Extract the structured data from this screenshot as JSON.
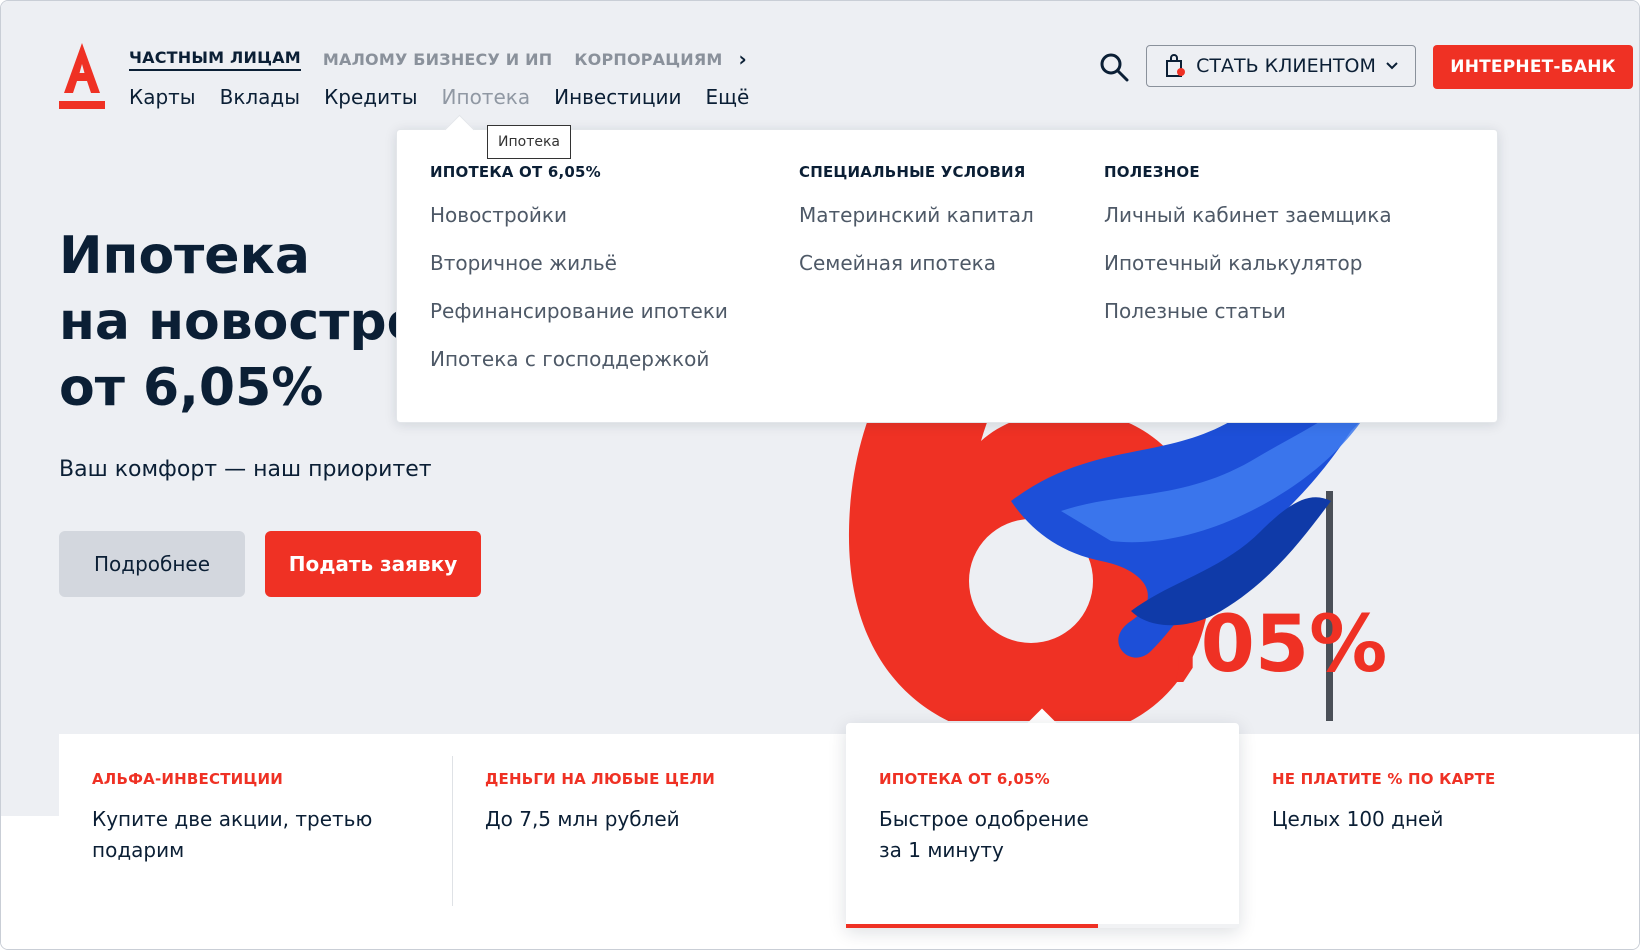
{
  "header": {
    "segments": [
      "ЧАСТНЫМ ЛИЦАМ",
      "МАЛОМУ БИЗНЕСУ И ИП",
      "КОРПОРАЦИЯМ"
    ],
    "active_segment": "ЧАСТНЫМ ЛИЦАМ",
    "nav": [
      "Карты",
      "Вклады",
      "Кредиты",
      "Ипотека",
      "Инвестиции",
      "Ещё"
    ],
    "hovered_nav": "Ипотека",
    "become_client": "СТАТЬ КЛИЕНТОМ",
    "internet_bank": "ИНТЕРНЕТ-БАНК",
    "search_icon": "search-icon",
    "brand_color": "#ef3124"
  },
  "tooltip": "Ипотека",
  "dropdown": {
    "columns": [
      {
        "heading": "ИПОТЕКА ОТ 6,05%",
        "items": [
          "Новостройки",
          "Вторичное жильё",
          "Рефинансирование ипотеки",
          "Ипотека с господдержкой"
        ]
      },
      {
        "heading": "СПЕЦИАЛЬНЫЕ УСЛОВИЯ",
        "items": [
          "Материнский капитал",
          "Семейная ипотека"
        ]
      },
      {
        "heading": "ПОЛЕЗНОЕ",
        "items": [
          "Личный кабинет заемщика",
          "Ипотечный калькулятор",
          "Полезные статьи"
        ]
      }
    ]
  },
  "hero": {
    "title_lines": [
      "Ипотека",
      "на новостро",
      "от 6,05%"
    ],
    "subtitle": "Ваш комфорт — наш приоритет",
    "more_button": "Подробнее",
    "apply_button": "Подать заявку",
    "rate_art": ",05%"
  },
  "promos": [
    {
      "label": "АЛЬФА-ИНВЕСТИЦИИ",
      "text": "Купите две акции, третью подарим"
    },
    {
      "label": "ДЕНЬГИ НА ЛЮБЫЕ ЦЕЛИ",
      "text": "До 7,5 млн рублей"
    },
    {
      "label": "ИПОТЕКА ОТ 6,05%",
      "text": "Быстрое одобрение за 1 минуту",
      "active": true,
      "progress": 0.64
    },
    {
      "label": "НЕ ПЛАТИТЕ % ПО КАРТЕ",
      "text": "Целых 100 дней"
    }
  ]
}
